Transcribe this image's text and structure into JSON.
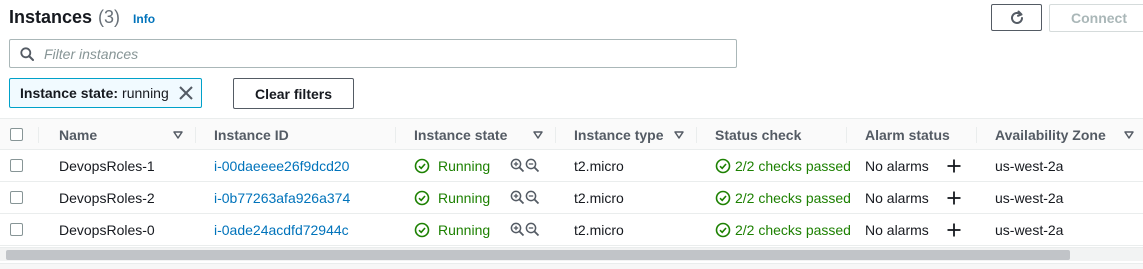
{
  "header": {
    "title": "Instances",
    "count": "(3)",
    "info_label": "Info"
  },
  "actions": {
    "connect_label": "Connect"
  },
  "search": {
    "placeholder": "Filter instances"
  },
  "filter_token": {
    "key": "Instance state:",
    "value": "running"
  },
  "clear_filters_label": "Clear filters",
  "table": {
    "columns": [
      "Name",
      "Instance ID",
      "Instance state",
      "Instance type",
      "Status check",
      "Alarm status",
      "Availability Zone"
    ],
    "rows": [
      {
        "name": "DevopsRoles-1",
        "instance_id": "i-00daeeee26f9dcd20",
        "state": "Running",
        "type": "t2.micro",
        "status_check": "2/2 checks passed",
        "alarm": "No alarms",
        "az": "us-west-2a"
      },
      {
        "name": "DevopsRoles-2",
        "instance_id": "i-0b77263afa926a374",
        "state": "Running",
        "type": "t2.micro",
        "status_check": "2/2 checks passed",
        "alarm": "No alarms",
        "az": "us-west-2a"
      },
      {
        "name": "DevopsRoles-0",
        "instance_id": "i-0ade24acdfd72944c",
        "state": "Running",
        "type": "t2.micro",
        "status_check": "2/2 checks passed",
        "alarm": "No alarms",
        "az": "us-west-2a"
      }
    ]
  },
  "icons": {
    "refresh": "refresh-icon",
    "search": "search-icon",
    "close": "close-icon",
    "sort": "caret-down-icon",
    "running": "check-circle-icon",
    "zoom_in": "zoom-in-icon",
    "zoom_out": "zoom-out-icon",
    "add_alarm": "plus-icon"
  },
  "colors": {
    "link": "#0073bb",
    "success": "#1d8102",
    "token_border": "#00a1c9"
  }
}
